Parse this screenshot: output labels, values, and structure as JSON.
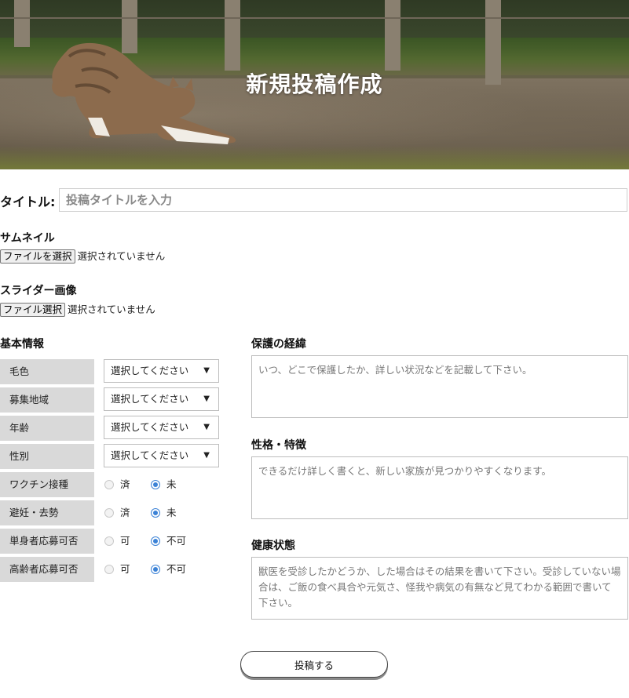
{
  "header": {
    "title": "新規投稿作成"
  },
  "title_field": {
    "label": "タイトル:",
    "placeholder": "投稿タイトルを入力"
  },
  "thumbnail": {
    "heading": "サムネイル",
    "button": "ファイルを選択",
    "status": "選択されていません"
  },
  "slider": {
    "heading": "スライダー画像",
    "button": "ファイル選択",
    "status": "選択されていません"
  },
  "basic_info": {
    "heading": "基本情報",
    "selects": [
      {
        "label": "毛色",
        "value": "選択してください"
      },
      {
        "label": "募集地域",
        "value": "選択してください"
      },
      {
        "label": "年齢",
        "value": "選択してください"
      },
      {
        "label": "性別",
        "value": "選択してください"
      }
    ],
    "radios": [
      {
        "label": "ワクチン接種",
        "option1": "済",
        "option2": "未",
        "selected": 2
      },
      {
        "label": "避妊・去勢",
        "option1": "済",
        "option2": "未",
        "selected": 2
      },
      {
        "label": "単身者応募可否",
        "option1": "可",
        "option2": "不可",
        "selected": 2
      },
      {
        "label": "高齢者応募可否",
        "option1": "可",
        "option2": "不可",
        "selected": 2
      }
    ]
  },
  "details": {
    "protection": {
      "heading": "保護の経緯",
      "placeholder": "いつ、どこで保護したか、詳しい状況などを記載して下さい。"
    },
    "personality": {
      "heading": "性格・特徴",
      "placeholder": "できるだけ詳しく書くと、新しい家族が見つかりやすくなります。"
    },
    "health": {
      "heading": "健康状態",
      "placeholder": "獣医を受診したかどうか、した場合はその結果を書いて下さい。受診していない場合は、ご飯の食べ具合や元気さ、怪我や病気の有無など見てわかる範囲で書いて下さい。"
    }
  },
  "submit": {
    "label": "投稿する"
  },
  "colors": {
    "radio_selected": "#3b82d6",
    "label_cell_bg": "#d9d9d9"
  }
}
